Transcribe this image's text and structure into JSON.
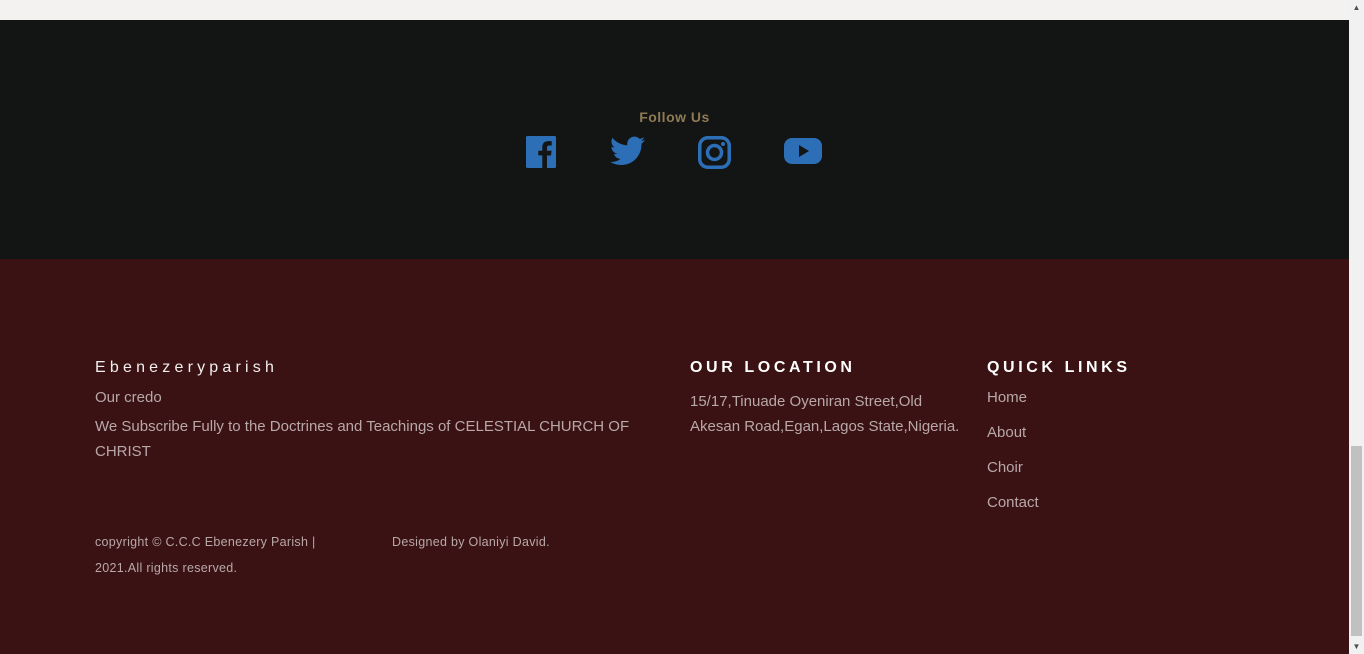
{
  "follow": {
    "title": "Follow Us",
    "icons": [
      {
        "name": "facebook-icon",
        "color": "#2d6fb7"
      },
      {
        "name": "twitter-icon",
        "color": "#2d6fb7"
      },
      {
        "name": "instagram-icon",
        "color": "#2d6fb7"
      },
      {
        "name": "youtube-icon",
        "color": "#2d6fb7"
      }
    ]
  },
  "footer": {
    "brand": "Ebenezeryparish",
    "credo_label": "Our credo",
    "credo_text": "We Subscribe Fully to the Doctrines and Teachings of CELESTIAL CHURCH OF CHRIST",
    "location_title": "OUR LOCATION",
    "location_text": "15/17,Tinuade Oyeniran Street,Old Akesan Road,Egan,Lagos State,Nigeria.",
    "quick_links_title": "QUICK LINKS",
    "quick_links": [
      "Home",
      "About",
      "Choir",
      "Contact"
    ],
    "copyright": "copyright © C.C.C Ebenezery Parish | 2021.All rights reserved.",
    "designed_by": "Designed by Olaniyi David."
  },
  "colors": {
    "social_bg": "#131414",
    "footer_bg": "#3a1214",
    "accent": "#8f7a55",
    "icon_blue": "#2d6fb7"
  }
}
